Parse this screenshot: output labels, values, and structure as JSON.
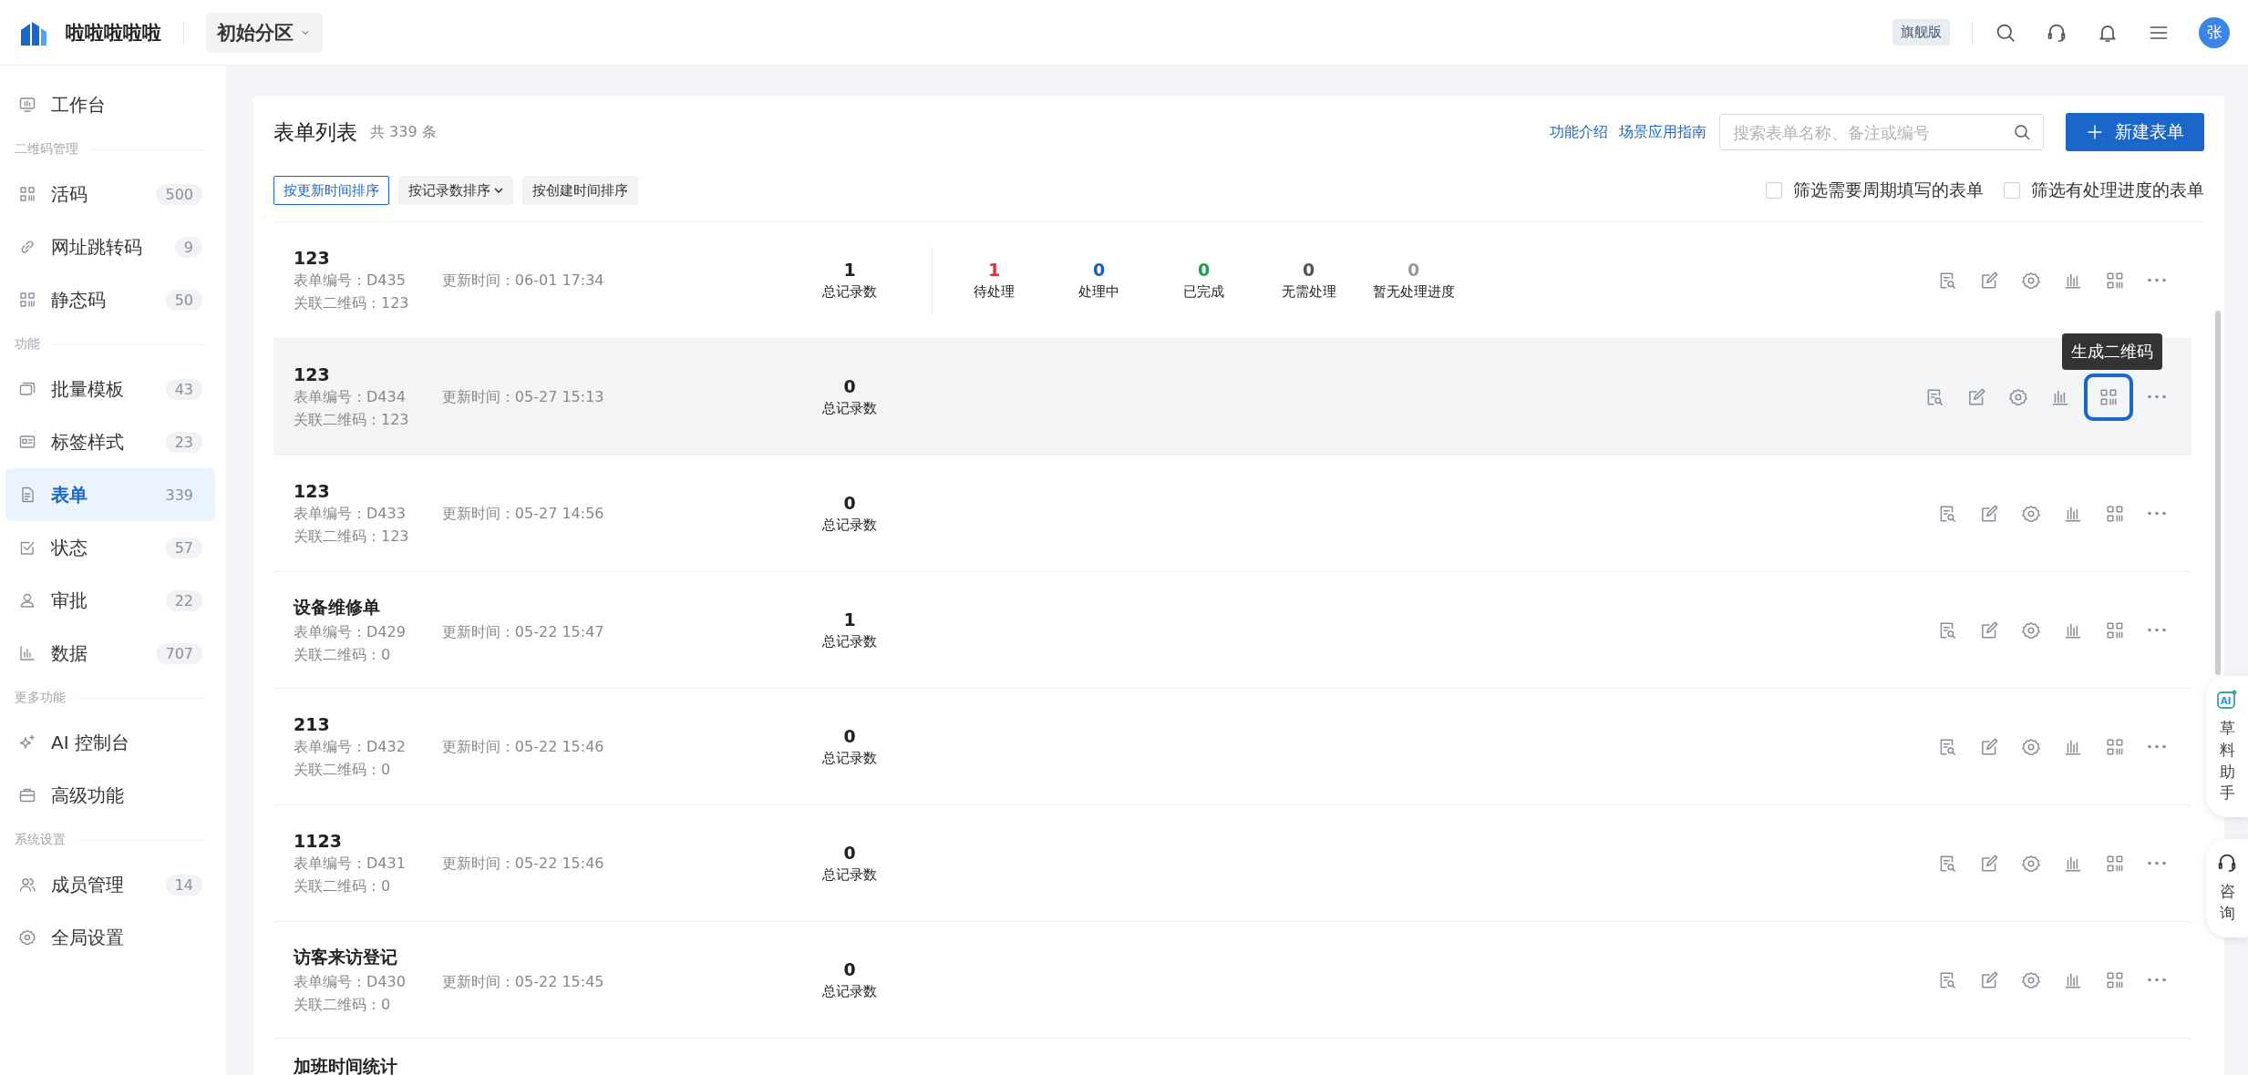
{
  "topbar": {
    "brand": "啦啦啦啦啦",
    "space": "初始分区",
    "plan": "旗舰版",
    "avatar": "张"
  },
  "sidebar": {
    "groups": [
      {
        "items": [
          {
            "label": "工作台",
            "selected": false
          }
        ]
      },
      {
        "label": "二维码管理",
        "items": [
          {
            "label": "活码",
            "count": "500",
            "selected": false
          },
          {
            "label": "网址跳转码",
            "count": "9",
            "selected": false
          },
          {
            "label": "静态码",
            "count": "50",
            "selected": false
          }
        ]
      },
      {
        "label": "功能",
        "items": [
          {
            "label": "批量模板",
            "count": "43",
            "selected": false
          },
          {
            "label": "标签样式",
            "count": "23",
            "selected": false
          },
          {
            "label": "表单",
            "count": "339",
            "selected": true
          },
          {
            "label": "状态",
            "count": "57",
            "selected": false
          },
          {
            "label": "审批",
            "count": "22",
            "selected": false
          },
          {
            "label": "数据",
            "count": "707",
            "selected": false
          }
        ]
      },
      {
        "label": "更多功能",
        "items": [
          {
            "label": "AI 控制台",
            "selected": false
          },
          {
            "label": "高级功能",
            "selected": false
          }
        ]
      },
      {
        "label": "系统设置",
        "items": [
          {
            "label": "成员管理",
            "count": "14",
            "selected": false
          },
          {
            "label": "全局设置",
            "selected": false
          }
        ]
      }
    ]
  },
  "list": {
    "title": "表单列表",
    "total": "共 339 条",
    "links": [
      "功能介绍",
      "场景应用指南"
    ],
    "search": {
      "placeholder": "搜索表单名称、备注或编号"
    },
    "new_button": "新建表单",
    "sorts": [
      {
        "label": "按更新时间排序",
        "selected": true,
        "dropdown": false
      },
      {
        "label": "按记录数排序",
        "selected": false,
        "dropdown": true
      },
      {
        "label": "按创建时间排序",
        "selected": false,
        "dropdown": false
      }
    ],
    "filters": [
      {
        "label": "筛选需要周期填写的表单",
        "checked": false
      },
      {
        "label": "筛选有处理进度的表单",
        "checked": false
      }
    ],
    "rows": [
      {
        "title": "123",
        "code": "表单编号：D435",
        "updated": "更新时间：06-01 17:34",
        "linked": "关联二维码：123",
        "records": "1",
        "records_label": "总记录数",
        "hovered": false,
        "stats": [
          {
            "value": "1",
            "label": "待处理",
            "color": "#d9363e"
          },
          {
            "value": "0",
            "label": "处理中",
            "color": "#1a5fb4"
          },
          {
            "value": "0",
            "label": "已完成",
            "color": "#1aa34a"
          },
          {
            "value": "0",
            "label": "无需处理",
            "color": "#555555"
          },
          {
            "value": "0",
            "label": "暂无处理进度",
            "color": "#999999"
          }
        ]
      },
      {
        "title": "123",
        "code": "表单编号：D434",
        "updated": "更新时间：05-27 15:13",
        "linked": "关联二维码：123",
        "records": "0",
        "records_label": "总记录数",
        "hovered": true,
        "tooltip": "生成二维码"
      },
      {
        "title": "123",
        "code": "表单编号：D433",
        "updated": "更新时间：05-27 14:56",
        "linked": "关联二维码：123",
        "records": "0",
        "records_label": "总记录数",
        "hovered": false
      },
      {
        "title": "设备维修单",
        "code": "表单编号：D429",
        "updated": "更新时间：05-22 15:47",
        "linked": "关联二维码：0",
        "records": "1",
        "records_label": "总记录数",
        "hovered": false
      },
      {
        "title": "213",
        "code": "表单编号：D432",
        "updated": "更新时间：05-22 15:46",
        "linked": "关联二维码：0",
        "records": "0",
        "records_label": "总记录数",
        "hovered": false
      },
      {
        "title": "1123",
        "code": "表单编号：D431",
        "updated": "更新时间：05-22 15:46",
        "linked": "关联二维码：0",
        "records": "0",
        "records_label": "总记录数",
        "hovered": false
      },
      {
        "title": "访客来访登记",
        "code": "表单编号：D430",
        "updated": "更新时间：05-22 15:45",
        "linked": "关联二维码：0",
        "records": "0",
        "records_label": "总记录数",
        "hovered": false
      },
      {
        "title": "加班时间统计",
        "hovered": false
      }
    ]
  },
  "float_buttons": [
    {
      "label": "草料助手",
      "icon_text": "AI"
    },
    {
      "label": "咨询"
    }
  ]
}
